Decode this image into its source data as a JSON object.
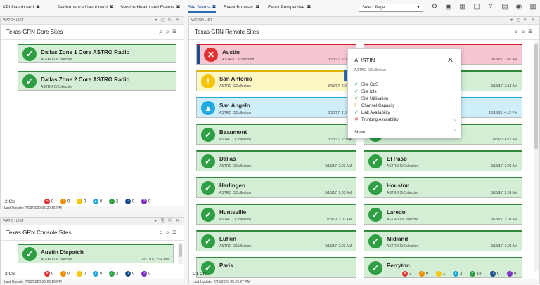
{
  "tabs": [
    {
      "label": "KPI Dashboard",
      "close": "✖"
    },
    {
      "label": "Performance Dashboard",
      "close": "✖"
    },
    {
      "label": "Service Health and Events",
      "close": "✖"
    },
    {
      "label": "Site Status",
      "close": "✖"
    },
    {
      "label": "Event Browser",
      "close": "✖"
    },
    {
      "label": "Event Perspective",
      "close": "✖"
    }
  ],
  "select_page": "Select Page",
  "watch_list_label": "WATCH LIST",
  "core": {
    "title": "Texas GRN Core Sites",
    "cards": [
      {
        "name": "Dallas Zone 1 Core ASTRO Radio",
        "sub": "ASTRO CiCollection",
        "date": "",
        "status": "green"
      },
      {
        "name": "Dallas Zone 2 Core ASTRO Radio",
        "sub": "ASTRO CiCollection",
        "date": "",
        "status": "green"
      }
    ],
    "count": "2 CIs",
    "counts": [
      "0",
      "0",
      "0",
      "0",
      "2",
      "0",
      "0"
    ],
    "last_update": "Last Update: 7/23/2020 05:29:16 PM"
  },
  "console": {
    "title": "Texas GRN Console Sites",
    "cards": [
      {
        "name": "Austin Dispatch",
        "sub": "ASTRO CiCollection",
        "date": "5/27/18, 3:04 PM",
        "status": "green"
      }
    ],
    "count": "2 CIs",
    "counts": [
      "0",
      "0",
      "0",
      "0",
      "2",
      "0",
      "0"
    ],
    "last_update": "Last Update: 7/23/2020 05:29:16 PM"
  },
  "remote": {
    "title": "Texas GRN Remote Sites",
    "cards_left": [
      {
        "name": "Austin",
        "sub": "ASTRO CiCollection",
        "date": "3/13/17, 2:03 A",
        "status": "red"
      },
      {
        "name": "San Antonio",
        "sub": "ASTRO CiCollection",
        "date": "3/13/17, 2:03 A",
        "status": "yellow"
      },
      {
        "name": "San Angelo",
        "sub": "ASTRO CiCollection",
        "date": "3/13/17, 2:03 A",
        "status": "cyan"
      },
      {
        "name": "Beaumont",
        "sub": "ASTRO CiCollection",
        "date": "3/13/17, 2:03 A",
        "status": "green"
      },
      {
        "name": "Dallas",
        "sub": "ASTRO CiCollection",
        "date": "3/13/17, 2:03 AM",
        "status": "green"
      },
      {
        "name": "Harlingen",
        "sub": "ASTRO CiCollection",
        "date": "3/13/17, 2:03 AM",
        "status": "green"
      },
      {
        "name": "Huntsville",
        "sub": "ASTRO CiCollection",
        "date": "1/13/19, 2:03 AM",
        "status": "green"
      },
      {
        "name": "Lufkin",
        "sub": "ASTRO CiCollection",
        "date": "3/13/17, 2:03 AM",
        "status": "green"
      },
      {
        "name": "Paris",
        "sub": "",
        "date": "",
        "status": "green"
      }
    ],
    "cards_right": [
      {
        "name": "",
        "sub": "",
        "date": "3/13/17, 1:41 AM",
        "status": "red"
      },
      {
        "name": "",
        "sub": "",
        "date": "3/13/17, 2:18 AM",
        "status": "green"
      },
      {
        "name": "",
        "sub": "",
        "date": "12/13/18, 4:12 PM",
        "status": "cyan"
      },
      {
        "name": "",
        "sub": "",
        "date": "6/5/20, 4:17 AM",
        "status": "green"
      },
      {
        "name": "El Paso",
        "sub": "ASTRO CiCollection",
        "date": "3/13/17, 2:29 AM",
        "status": "green"
      },
      {
        "name": "Houston",
        "sub": "ASTRO CiCollection",
        "date": "3/13/17, 2:03 AM",
        "status": "green"
      },
      {
        "name": "Laredo",
        "sub": "ASTRO CiCollection",
        "date": "3/13/17, 2:03 AM",
        "status": "green"
      },
      {
        "name": "Midland",
        "sub": "ASTRO CiCollection",
        "date": "3/13/17, 2:03 AM",
        "status": "green"
      },
      {
        "name": "Perryton",
        "sub": "",
        "date": "",
        "status": "green"
      }
    ],
    "count": "21 CIs",
    "counts": [
      "2",
      "0",
      "1",
      "2",
      "16",
      "0",
      "0"
    ],
    "last_update": "Last Update: 7/23/2020 05:29:27 PM"
  },
  "popup": {
    "title": "AUSTIN",
    "subtitle": "ASTRO CiCollection",
    "close": "✕",
    "items": [
      {
        "label": "Site GoS",
        "icon": "check-icon",
        "color": "#2f9e44"
      },
      {
        "label": "Site Idle",
        "icon": "check-icon",
        "color": "#2f9e44"
      },
      {
        "label": "Site Utilisation",
        "icon": "check-icon",
        "color": "#2f9e44"
      },
      {
        "label": "Channel Capacity",
        "icon": "warning-icon",
        "color": "#f08c00"
      },
      {
        "label": "Link Availability",
        "icon": "check-icon",
        "color": "#2f9e44"
      },
      {
        "label": "Trunking Availability",
        "icon": "error-icon",
        "color": "#e03131"
      }
    ],
    "show": "Show"
  },
  "status_colors": {
    "green": "#2f9e44",
    "red": "#e03131",
    "yellow": "#f5c400",
    "cyan": "#22a8e0",
    "orange": "#f08c00",
    "navy": "#1d4f8c",
    "purple": "#7b2fbe"
  }
}
